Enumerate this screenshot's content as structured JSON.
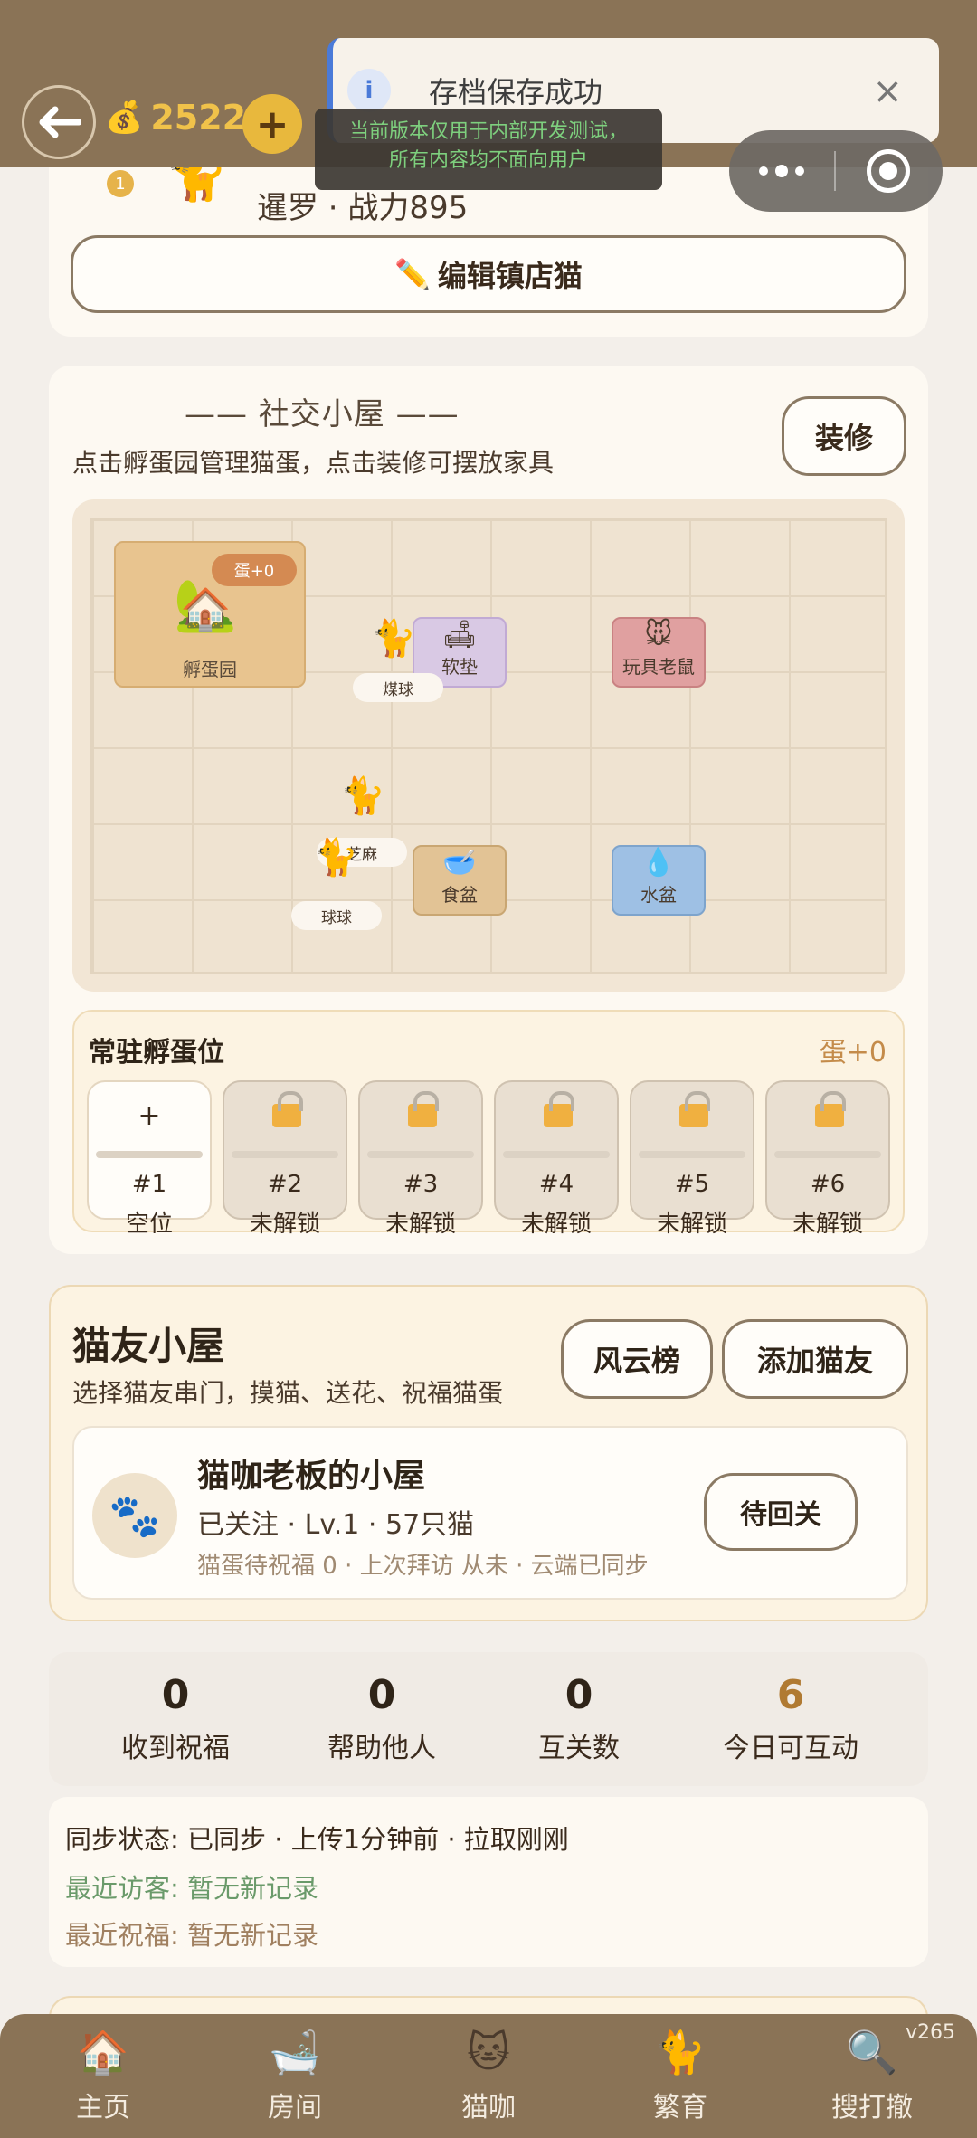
{
  "toast": {
    "text": "存档保存成功",
    "close": "×"
  },
  "dev_note": {
    "line1": "当前版本仅用于内部开发测试，",
    "line2": "所有内容均不面向用户"
  },
  "header": {
    "coins": "25221"
  },
  "shop_cat": {
    "rank": "1",
    "desc": "暹罗 · 战力895",
    "edit_label": "编辑镇店猫"
  },
  "social": {
    "title": "—— 社交小屋 ——",
    "subtitle": "点击孵蛋园管理猫蛋，点击装修可摆放家具",
    "decorate_label": "装修",
    "hatchery": {
      "label": "孵蛋园",
      "badge": "蛋+0"
    },
    "furniture": {
      "pad": "软垫",
      "mouse": "玩具老鼠",
      "food": "食盆",
      "water": "水盆"
    },
    "cats": {
      "coal": "煤球",
      "sesame": "芝麻",
      "ball": "球球"
    }
  },
  "incubator": {
    "title": "常驻孵蛋位",
    "count": "蛋+0",
    "slots": [
      {
        "num": "#1",
        "status": "空位",
        "open": true,
        "icon": "+"
      },
      {
        "num": "#2",
        "status": "未解锁",
        "open": false
      },
      {
        "num": "#3",
        "status": "未解锁",
        "open": false
      },
      {
        "num": "#4",
        "status": "未解锁",
        "open": false
      },
      {
        "num": "#5",
        "status": "未解锁",
        "open": false
      },
      {
        "num": "#6",
        "status": "未解锁",
        "open": false
      }
    ]
  },
  "friends": {
    "title": "猫友小屋",
    "subtitle": "选择猫友串门，摸猫、送花、祝福猫蛋",
    "rank_label": "风云榜",
    "add_label": "添加猫友",
    "house": {
      "name": "猫咖老板的小屋",
      "meta": "已关注 · Lv.1 · 57只猫",
      "status": "猫蛋待祝福 0 · 上次拜访 从未 · 云端已同步",
      "follow_label": "待回关"
    }
  },
  "stats": [
    {
      "value": "0",
      "label": "收到祝福"
    },
    {
      "value": "0",
      "label": "帮助他人"
    },
    {
      "value": "0",
      "label": "互关数"
    },
    {
      "value": "6",
      "label": "今日可互动"
    }
  ],
  "sync": {
    "status": "同步状态: 已同步 · 上传1分钟前 · 拉取刚刚",
    "visitors": "最近访客: 暂无新记录",
    "blessings": "最近祝福: 暂无新记录"
  },
  "tabs": [
    {
      "label": "主页",
      "icon": "home-icon"
    },
    {
      "label": "房间",
      "icon": "room-icon"
    },
    {
      "label": "猫咖",
      "icon": "cafe-icon"
    },
    {
      "label": "繁育",
      "icon": "breeding-icon"
    },
    {
      "label": "搜打撤",
      "icon": "search-raid-icon"
    }
  ],
  "version": "v265",
  "colors": {
    "header_bg": "#8a7356",
    "coin": "#f0c24a",
    "accent": "#b07a32",
    "visitor": "#6a9a6a"
  }
}
